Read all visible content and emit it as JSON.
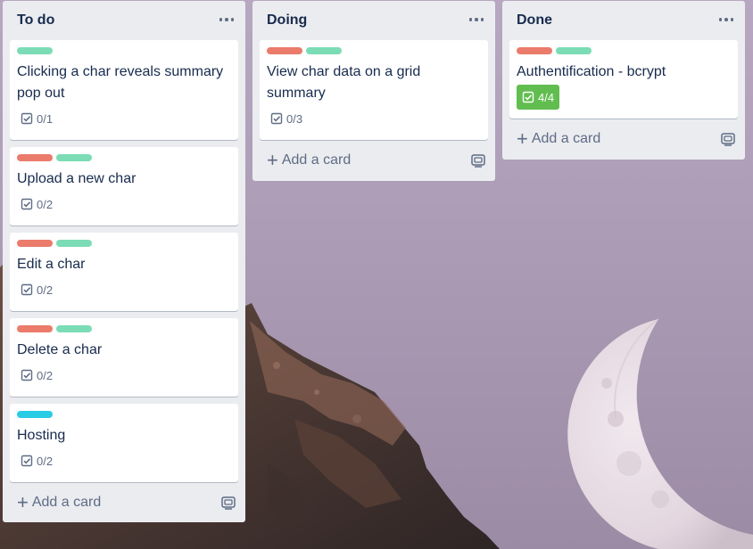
{
  "colors": {
    "label_green": "#7bdcb5",
    "label_red": "#eb7b6b",
    "label_cyan": "#29cce5",
    "complete_green": "#61bd4f",
    "list_bg": "#ebecf0",
    "text_dark": "#172b4d",
    "text_muted": "#5e6c84"
  },
  "lists": [
    {
      "title": "To do",
      "menu_icon": "ellipsis-icon",
      "add_card_label": "Add a card",
      "cards": [
        {
          "title": "Clicking a char reveals summary pop out",
          "labels": [
            "green"
          ],
          "checklist": "0/1"
        },
        {
          "title": "Upload a new char",
          "labels": [
            "red",
            "green"
          ],
          "checklist": "0/2"
        },
        {
          "title": "Edit a char",
          "labels": [
            "red",
            "green"
          ],
          "checklist": "0/2"
        },
        {
          "title": "Delete a char",
          "labels": [
            "red",
            "green"
          ],
          "checklist": "0/2"
        },
        {
          "title": "Hosting",
          "labels": [
            "cyan"
          ],
          "checklist": "0/2"
        }
      ]
    },
    {
      "title": "Doing",
      "menu_icon": "ellipsis-icon",
      "add_card_label": "Add a card",
      "cards": [
        {
          "title": "View char data on a grid summary",
          "labels": [
            "red",
            "green"
          ],
          "checklist": "0/3"
        }
      ]
    },
    {
      "title": "Done",
      "menu_icon": "ellipsis-icon",
      "add_card_label": "Add a card",
      "cards": [
        {
          "title": "Authentification - bcrypt",
          "labels": [
            "red",
            "green"
          ],
          "checklist": "4/4",
          "checklist_complete": true
        }
      ]
    }
  ]
}
